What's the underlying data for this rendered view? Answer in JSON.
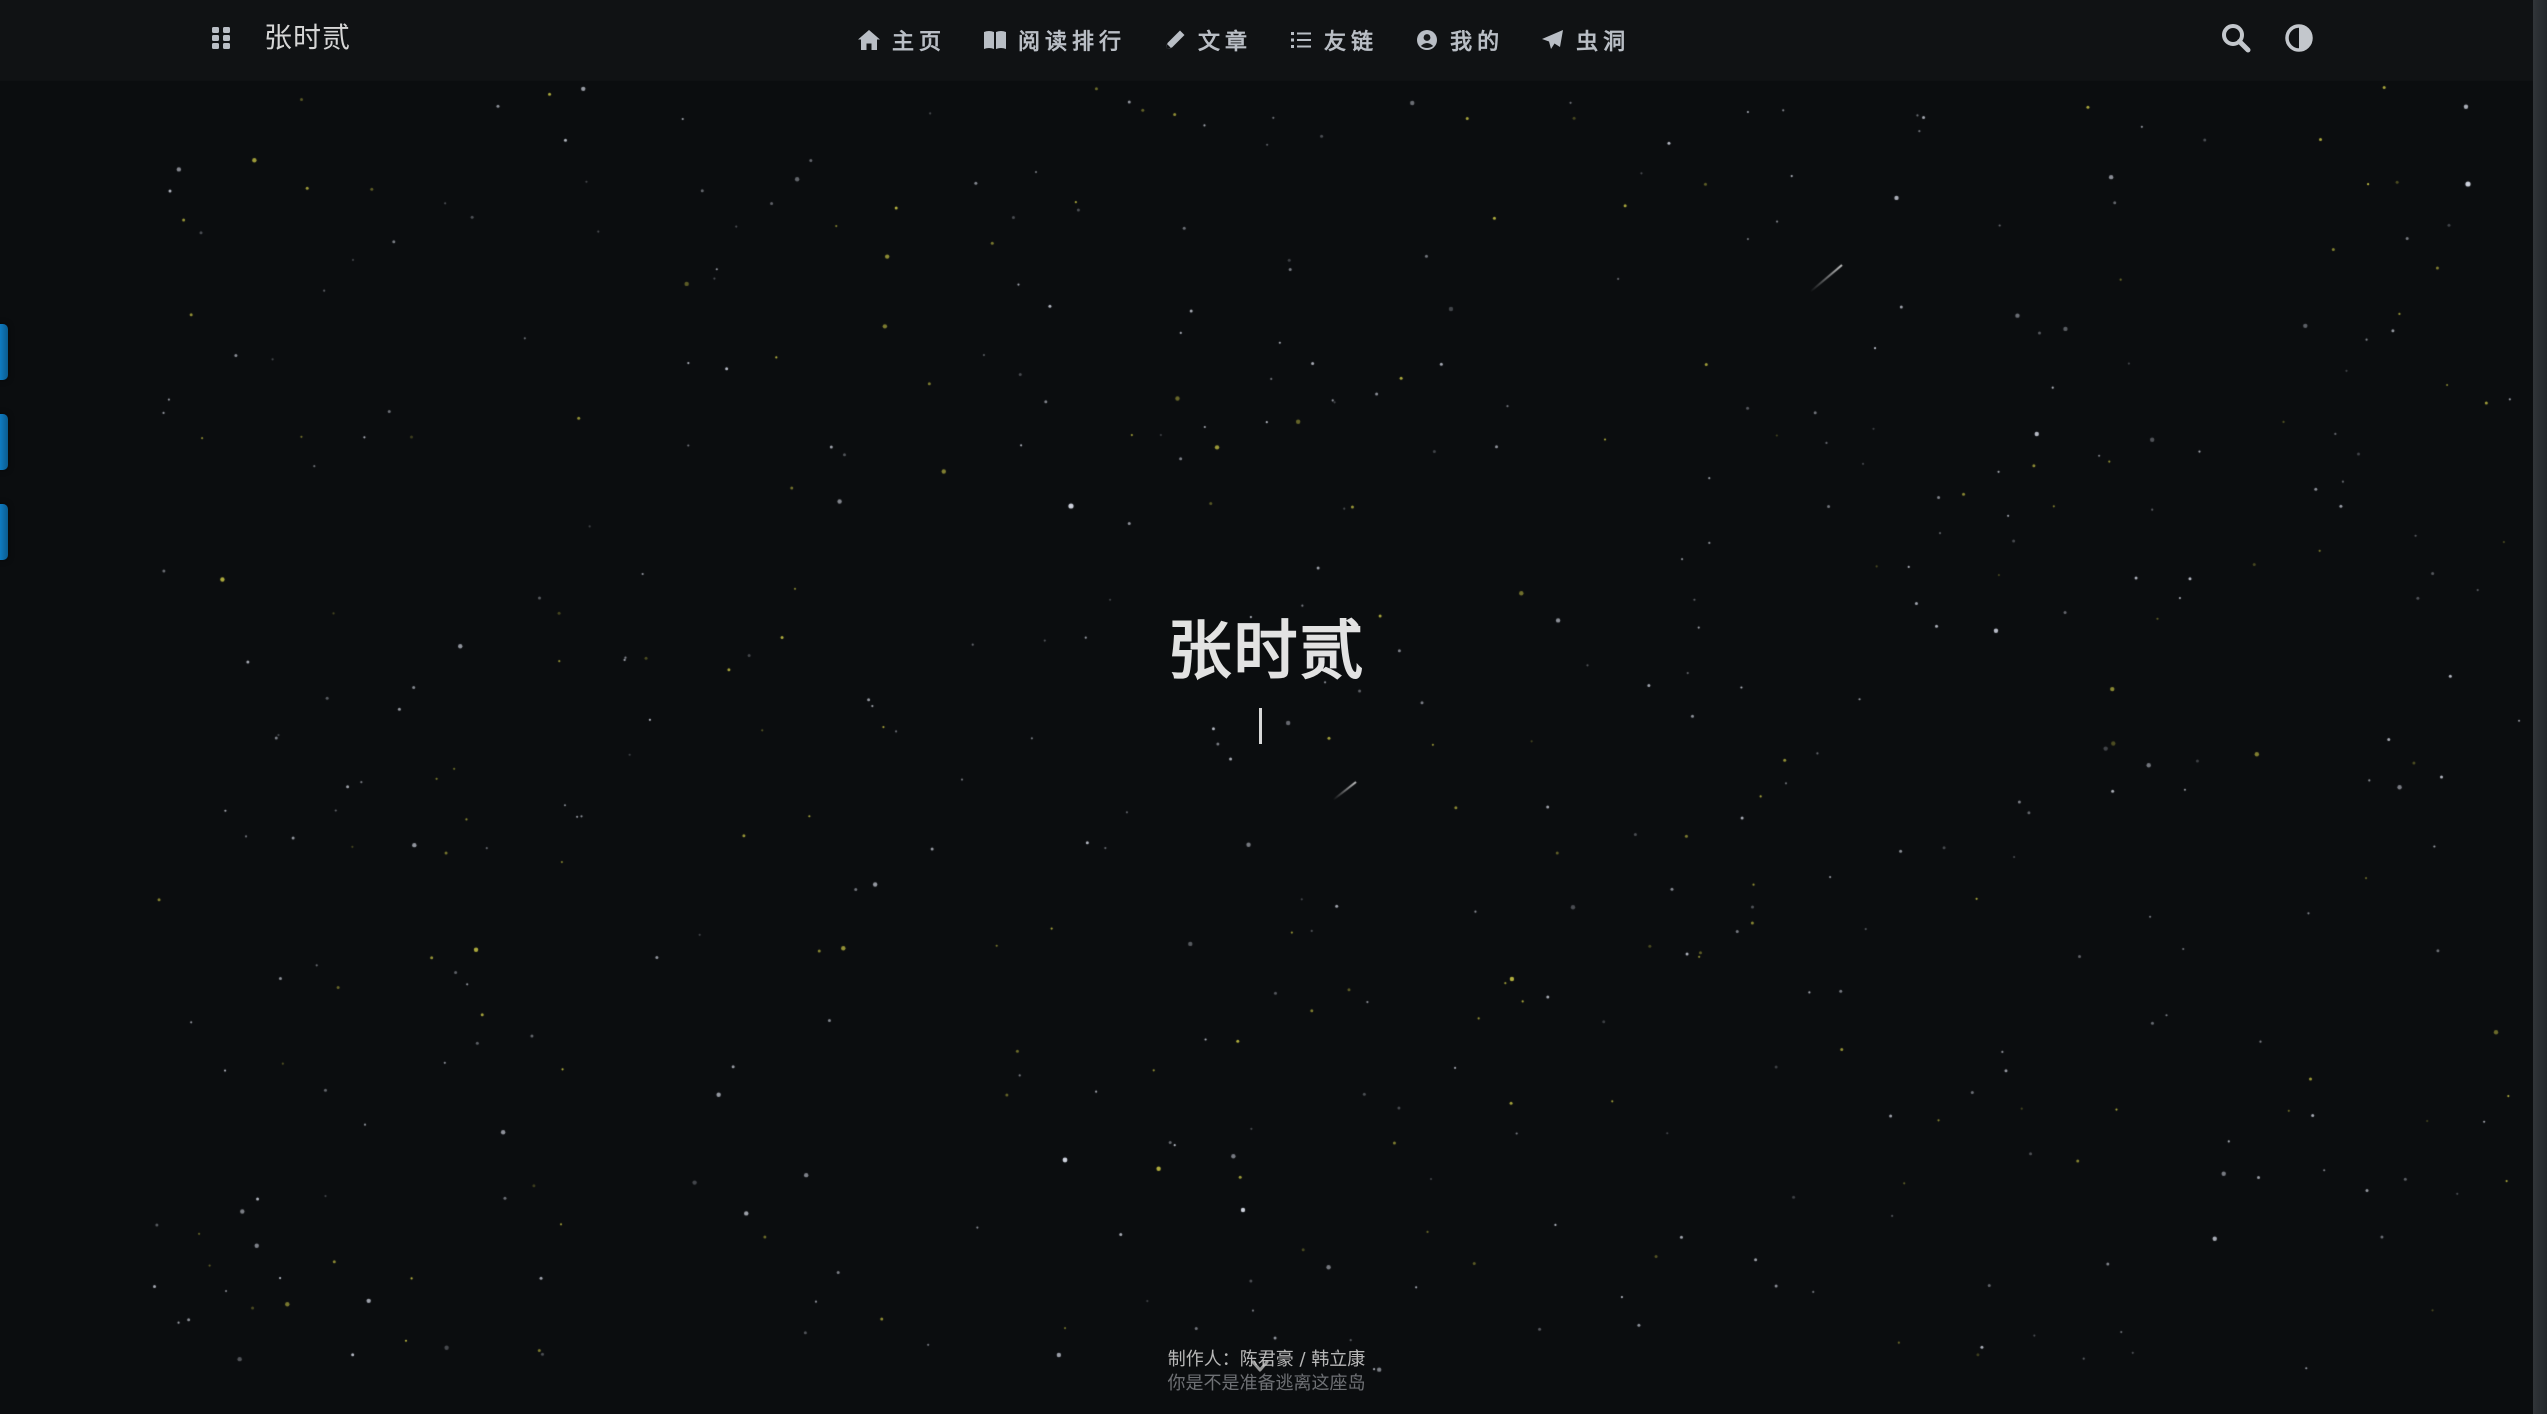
{
  "site": {
    "brand": "张时贰",
    "hero_title": "张时贰"
  },
  "nav": {
    "items": [
      {
        "label": "主页",
        "icon": "home-icon"
      },
      {
        "label": "阅读排行",
        "icon": "book-icon"
      },
      {
        "label": "文章",
        "icon": "pencil-icon"
      },
      {
        "label": "友链",
        "icon": "list-icon"
      },
      {
        "label": "我的",
        "icon": "user-circle-icon"
      },
      {
        "label": "虫洞",
        "icon": "paper-plane-icon"
      }
    ]
  },
  "toolbar": {
    "menu_icon": "grid-icon",
    "search_icon": "search-icon",
    "theme_icon": "contrast-icon"
  },
  "footer": {
    "credits": "制作人：陈君豪 / 韩立康",
    "subtitle": "你是不是准备逃离这座岛"
  },
  "colors": {
    "background": "#0b0d0f",
    "nav_text": "#b9bec5",
    "accent_tab": "#0f7bc1",
    "star_yellow": "#d8d44a",
    "star_white": "#d8dce8"
  }
}
